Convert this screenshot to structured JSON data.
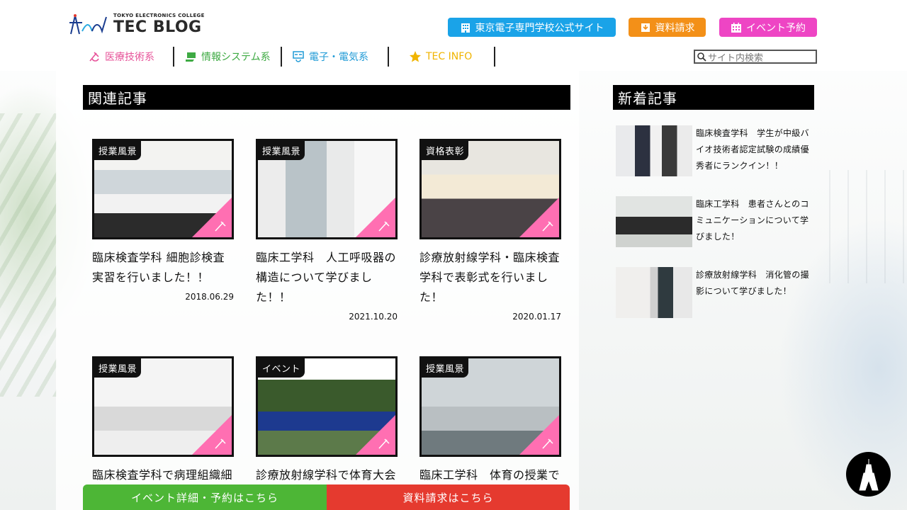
{
  "logo": {
    "sub": "TOKYO ELECTRONICS COLLEGE",
    "title": "TEC BLOG"
  },
  "top_buttons": {
    "official": "東京電子専門学校公式サイト",
    "docs": "資料請求",
    "event": "イベント予約"
  },
  "nav": [
    {
      "label": "医療技術系",
      "color": "#e7549a"
    },
    {
      "label": "情報システム系",
      "color": "#3eaa43"
    },
    {
      "label": "電子・電気系",
      "color": "#1f9ad6"
    },
    {
      "label": "TEC INFO",
      "color": "#f0b400"
    }
  ],
  "search": {
    "placeholder": "サイト内検索"
  },
  "related": {
    "heading": "関連記事",
    "cards": [
      {
        "tag": "授業風景",
        "title": "臨床検査学科 細胞診検査実習を行いました！！",
        "date": "2018.06.29"
      },
      {
        "tag": "授業風景",
        "title": "臨床工学科　人工呼吸器の構造について学びました！！",
        "date": "2021.10.20"
      },
      {
        "tag": "資格表彰",
        "title": "診療放射線学科・臨床検査学科で表彰式を行いました！",
        "date": "2020.01.17"
      },
      {
        "tag": "授業風景",
        "title": "臨床検査学科で病理組織細",
        "date": ""
      },
      {
        "tag": "イベント",
        "title": "診療放射線学科で体育大会",
        "date": ""
      },
      {
        "tag": "授業風景",
        "title": "臨床工学科　体育の授業で",
        "date": ""
      }
    ]
  },
  "latest": {
    "heading": "新着記事",
    "items": [
      {
        "title": "臨床検査学科　学生が中級バイオ技術者認定試験の成績優秀者にランクイン！！"
      },
      {
        "title": "臨床工学科　患者さんとのコミュニケーションについて学びました！"
      },
      {
        "title": "診療放射線学科　消化管の撮影について学びました！"
      }
    ]
  },
  "cta": {
    "event": "イベント詳細・予約はこちら",
    "docs": "資料請求はこちら"
  },
  "colors": {
    "green": "#4db636",
    "red": "#e53a2f",
    "pink": "#ff6fb2",
    "blue": "#1aa3e8",
    "orange": "#f39018",
    "magenta": "#ee45c4"
  },
  "icons": [
    "building-icon",
    "document-icon",
    "calendar-icon",
    "medical-icon",
    "computer-icon",
    "circuit-icon",
    "star-icon",
    "search-icon",
    "tower-icon"
  ]
}
